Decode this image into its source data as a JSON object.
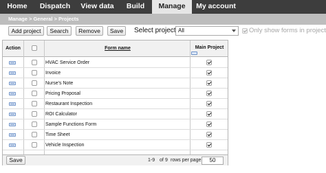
{
  "nav": {
    "tabs": [
      {
        "label": "Home",
        "active": false
      },
      {
        "label": "Dispatch",
        "active": false
      },
      {
        "label": "View data",
        "active": false
      },
      {
        "label": "Build",
        "active": false
      },
      {
        "label": "Manage",
        "active": true
      },
      {
        "label": "My account",
        "active": false
      }
    ]
  },
  "breadcrumb": "Manage > General > Projects",
  "toolbar": {
    "add_project": "Add project",
    "search": "Search",
    "remove": "Remove",
    "save": "Save",
    "select_project_label": "Select project",
    "select_project_value": "All",
    "only_show_label": "Only show forms in project",
    "only_show_checked": true,
    "only_show_disabled": true
  },
  "table": {
    "headers": {
      "action": "Action",
      "form_name": "Form name",
      "main_project": "Main Project"
    },
    "select_all_checked": false,
    "rows": [
      {
        "form_name": "HVAC Service Order",
        "selected": false,
        "main_project": true
      },
      {
        "form_name": "Invoice",
        "selected": false,
        "main_project": true
      },
      {
        "form_name": "Nurse's Note",
        "selected": false,
        "main_project": true
      },
      {
        "form_name": "Pricing Proposal",
        "selected": false,
        "main_project": true
      },
      {
        "form_name": "Restaurant Inspection",
        "selected": false,
        "main_project": true
      },
      {
        "form_name": "ROI Calculator",
        "selected": false,
        "main_project": true
      },
      {
        "form_name": "Sample Functions Form",
        "selected": false,
        "main_project": true
      },
      {
        "form_name": "Time Sheet",
        "selected": false,
        "main_project": true
      },
      {
        "form_name": "Vehicle Inspection",
        "selected": false,
        "main_project": true
      }
    ]
  },
  "footer": {
    "save": "Save",
    "range": "1-9",
    "of_label": "of",
    "total": "9",
    "rows_per_page_label": "rows per page:",
    "rows_per_page": "50"
  },
  "icons": {
    "edit": "edit-icon",
    "sort": "sort-icon"
  },
  "colors": {
    "nav_bg": "#3d3d3d",
    "nav_active_bg": "#e6e6e6",
    "breadcrumb_bg": "#bdbdbd",
    "icon_blue": "#6f93c8"
  }
}
